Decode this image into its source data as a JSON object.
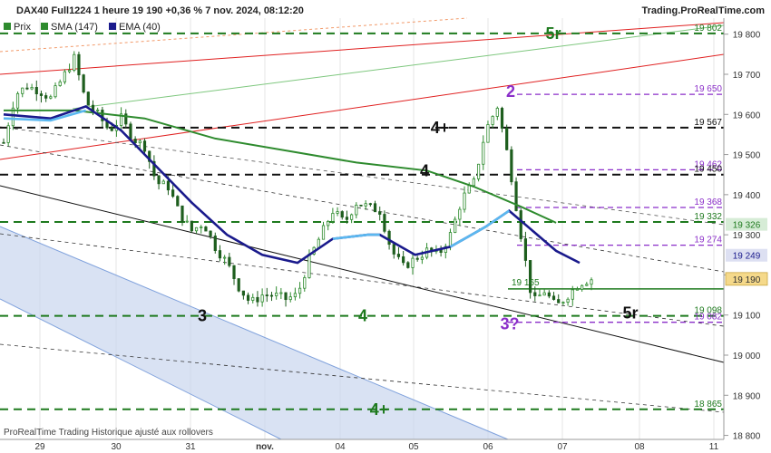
{
  "header": {
    "title": "DAX40 Full1224 1 heure 19 190 +0,36 % 7 nov. 2024, 08:12:20",
    "brand": "Trading.ProRealTime.com"
  },
  "legend": [
    {
      "label": "Prix",
      "color": "#2e8b2e"
    },
    {
      "label": "SMA (147)",
      "color": "#2e8b2e"
    },
    {
      "label": "EMA (40)",
      "color": "#1a1a8c"
    }
  ],
  "footer": "ProRealTime Trading Historique ajusté aux rollovers",
  "colors": {
    "up": "#2e8b2e",
    "sma": "#2e8b2e",
    "ema": "#1a1a8c",
    "ema_light": "#5bb8f0",
    "green_level": "#1e7a1e",
    "purple_level": "#8b2fc9",
    "black_level": "#111111",
    "red_line": "#e02020",
    "channel_fill": "#c9d6ee",
    "price_badge": "#f5d98a"
  },
  "chart_data": {
    "type": "candlestick",
    "ylim": [
      18790,
      19840
    ],
    "yticks": [
      18800,
      18900,
      19000,
      19100,
      19200,
      19300,
      19400,
      19500,
      19600,
      19700,
      19800
    ],
    "x_dates": [
      "2024-10-28",
      "2024-10-29",
      "2024-10-30",
      "2024-10-31",
      "2024-11-01",
      "2024-11-04",
      "2024-11-05",
      "2024-11-06",
      "2024-11-07",
      "2024-11-08",
      "2024-11-11"
    ],
    "x_tick_labels": [
      "29",
      "30",
      "31",
      "nov.",
      "04",
      "05",
      "06",
      "07",
      "08",
      "11"
    ],
    "last_price": 19190,
    "last_price_label": "19 190",
    "price_series": [
      [
        0,
        19530
      ],
      [
        5,
        19650
      ],
      [
        10,
        19670
      ],
      [
        15,
        19660
      ],
      [
        20,
        19640
      ],
      [
        25,
        19690
      ],
      [
        30,
        19740
      ],
      [
        35,
        19630
      ],
      [
        40,
        19600
      ],
      [
        45,
        19560
      ],
      [
        50,
        19590
      ],
      [
        55,
        19540
      ],
      [
        60,
        19520
      ],
      [
        65,
        19430
      ],
      [
        70,
        19420
      ],
      [
        75,
        19350
      ],
      [
        80,
        19310
      ],
      [
        85,
        19330
      ],
      [
        90,
        19270
      ],
      [
        95,
        19230
      ],
      [
        100,
        19170
      ],
      [
        105,
        19130
      ],
      [
        110,
        19150
      ],
      [
        115,
        19150
      ],
      [
        120,
        19140
      ],
      [
        125,
        19150
      ],
      [
        130,
        19240
      ],
      [
        135,
        19300
      ],
      [
        140,
        19360
      ],
      [
        145,
        19330
      ],
      [
        150,
        19380
      ],
      [
        155,
        19370
      ],
      [
        160,
        19360
      ],
      [
        165,
        19260
      ],
      [
        170,
        19220
      ],
      [
        175,
        19240
      ],
      [
        180,
        19260
      ],
      [
        185,
        19250
      ],
      [
        190,
        19300
      ],
      [
        195,
        19390
      ],
      [
        200,
        19430
      ],
      [
        205,
        19560
      ],
      [
        210,
        19620
      ],
      [
        215,
        19480
      ],
      [
        220,
        19300
      ],
      [
        225,
        19130
      ],
      [
        230,
        19160
      ],
      [
        235,
        19120
      ],
      [
        240,
        19150
      ],
      [
        245,
        19180
      ],
      [
        250,
        19190
      ]
    ],
    "sma_series": [
      [
        0,
        19610
      ],
      [
        30,
        19610
      ],
      [
        60,
        19590
      ],
      [
        90,
        19540
      ],
      [
        120,
        19510
      ],
      [
        150,
        19480
      ],
      [
        180,
        19460
      ],
      [
        200,
        19420
      ],
      [
        220,
        19370
      ],
      [
        235,
        19330
      ]
    ],
    "ema_series": [
      [
        0,
        19600
      ],
      [
        20,
        19590
      ],
      [
        35,
        19620
      ],
      [
        50,
        19560
      ],
      [
        65,
        19470
      ],
      [
        80,
        19380
      ],
      [
        95,
        19300
      ],
      [
        110,
        19250
      ],
      [
        125,
        19230
      ],
      [
        140,
        19290
      ],
      [
        155,
        19300
      ],
      [
        160,
        19300
      ],
      [
        175,
        19250
      ],
      [
        190,
        19270
      ],
      [
        205,
        19320
      ],
      [
        215,
        19360
      ],
      [
        225,
        19310
      ],
      [
        235,
        19260
      ],
      [
        245,
        19230
      ]
    ],
    "levels": [
      {
        "value": 19802,
        "label": "19 802",
        "color": "green",
        "big": "5r"
      },
      {
        "value": 19650,
        "label": "19 650",
        "color": "purple",
        "big": "2"
      },
      {
        "value": 19567,
        "label": "19 567",
        "color": "black",
        "big": "4+"
      },
      {
        "value": 19462,
        "label": "19 462",
        "color": "purple",
        "big": ""
      },
      {
        "value": 19450,
        "label": "19 450",
        "color": "black",
        "big": "4"
      },
      {
        "value": 19368,
        "label": "19 368",
        "color": "purple",
        "big": ""
      },
      {
        "value": 19332,
        "label": "19 332",
        "color": "green",
        "big": ""
      },
      {
        "value": 19326,
        "label": "19 326",
        "color": "green",
        "big": ""
      },
      {
        "value": 19274,
        "label": "19 274",
        "color": "purple",
        "big": ""
      },
      {
        "value": 19249,
        "label": "19 249",
        "color": "ema",
        "big": ""
      },
      {
        "value": 19165,
        "label": "19 165",
        "color": "green",
        "big": ""
      },
      {
        "value": 19098,
        "label": "19 098",
        "color": "green",
        "big": "4"
      },
      {
        "value": 19082,
        "label": "19 082",
        "color": "purple",
        "big": "3?"
      },
      {
        "value": 18865,
        "label": "18 865",
        "color": "green",
        "big": "4+"
      }
    ],
    "annotations": [
      "5r",
      "2",
      "4+",
      "4",
      "3",
      "4",
      "3?",
      "5r",
      "4+"
    ]
  }
}
